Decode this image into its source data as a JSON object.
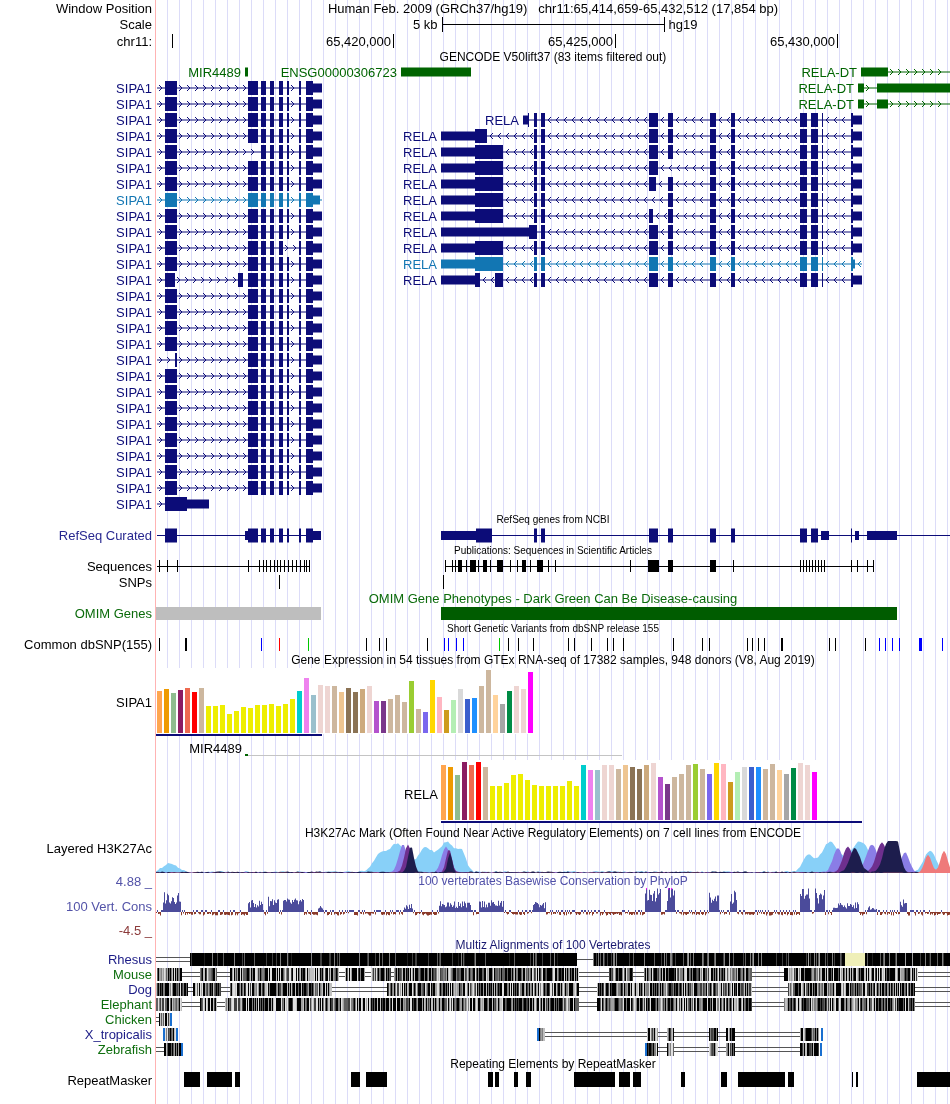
{
  "header": {
    "label": "Window Position",
    "assembly": "Human Feb. 2009 (GRCh37/hg19)",
    "position": "chr11:65,414,659-65,432,512 (17,854 bp)"
  },
  "scale": {
    "label": "Scale",
    "length": "5 kb",
    "assembly": "hg19"
  },
  "ruler": {
    "label": "chr11:",
    "ticks": [
      "65,420,000",
      "65,425,000",
      "65,430,000"
    ]
  },
  "gencode_track": {
    "title": "GENCODE V50lift37 (83 items filtered out)",
    "rows": [
      [
        {
          "label": "MIR4489",
          "color": "#006400"
        },
        {
          "label": "ENSG00000306723",
          "color": "#006400"
        },
        {
          "label": "RELA-DT",
          "color": "#006400"
        }
      ],
      [
        {
          "label": "SIPA1",
          "color": "#0c0c78"
        },
        {
          "label": "RELA-DT",
          "color": "#006400"
        }
      ],
      [
        {
          "label": "SIPA1",
          "color": "#0c0c78"
        },
        {
          "label": "RELA-DT",
          "color": "#006400"
        }
      ],
      [
        {
          "label": "SIPA1",
          "color": "#0c0c78"
        },
        {
          "label": "RELA",
          "color": "#0c0c78"
        }
      ],
      [
        {
          "label": "SIPA1",
          "color": "#0c0c78"
        },
        {
          "label": "RELA",
          "color": "#0c0c78"
        }
      ],
      [
        {
          "label": "SIPA1",
          "color": "#0c0c78"
        },
        {
          "label": "RELA",
          "color": "#0c0c78"
        }
      ],
      [
        {
          "label": "SIPA1",
          "color": "#0c0c78"
        },
        {
          "label": "RELA",
          "color": "#0c0c78"
        }
      ],
      [
        {
          "label": "SIPA1",
          "color": "#0c0c78"
        },
        {
          "label": "RELA",
          "color": "#0c0c78"
        }
      ],
      [
        {
          "label": "SIPA1",
          "color": "#1276b3"
        },
        {
          "label": "RELA",
          "color": "#0c0c78"
        }
      ],
      [
        {
          "label": "SIPA1",
          "color": "#0c0c78"
        },
        {
          "label": "RELA",
          "color": "#0c0c78"
        }
      ],
      [
        {
          "label": "SIPA1",
          "color": "#0c0c78"
        },
        {
          "label": "RELA",
          "color": "#0c0c78"
        }
      ],
      [
        {
          "label": "SIPA1",
          "color": "#0c0c78"
        },
        {
          "label": "RELA",
          "color": "#0c0c78"
        }
      ],
      [
        {
          "label": "SIPA1",
          "color": "#0c0c78"
        },
        {
          "label": "RELA",
          "color": "#1276b3"
        }
      ],
      [
        {
          "label": "SIPA1",
          "color": "#0c0c78"
        },
        {
          "label": "RELA",
          "color": "#0c0c78"
        }
      ],
      [
        {
          "label": "SIPA1",
          "color": "#0c0c78"
        }
      ],
      [
        {
          "label": "SIPA1",
          "color": "#0c0c78"
        }
      ],
      [
        {
          "label": "SIPA1",
          "color": "#0c0c78"
        }
      ],
      [
        {
          "label": "SIPA1",
          "color": "#0c0c78"
        }
      ],
      [
        {
          "label": "SIPA1",
          "color": "#0c0c78"
        }
      ],
      [
        {
          "label": "SIPA1",
          "color": "#0c0c78"
        }
      ],
      [
        {
          "label": "SIPA1",
          "color": "#0c0c78"
        }
      ],
      [
        {
          "label": "SIPA1",
          "color": "#0c0c78"
        }
      ],
      [
        {
          "label": "SIPA1",
          "color": "#0c0c78"
        }
      ],
      [
        {
          "label": "SIPA1",
          "color": "#0c0c78"
        }
      ],
      [
        {
          "label": "SIPA1",
          "color": "#0c0c78"
        }
      ],
      [
        {
          "label": "SIPA1",
          "color": "#0c0c78"
        }
      ],
      [
        {
          "label": "SIPA1",
          "color": "#0c0c78"
        }
      ],
      [
        {
          "label": "SIPA1",
          "color": "#0c0c78"
        }
      ]
    ]
  },
  "refseq_track": {
    "title": "RefSeq genes from NCBI",
    "label": "RefSeq Curated"
  },
  "publications_track": {
    "title": "Publications: Sequences in Scientific Articles",
    "label": "Sequences",
    "snp_label": "SNPs"
  },
  "omim_track": {
    "title": "OMIM Gene Phenotypes - Dark Green Can Be Disease-causing",
    "label": "OMIM Genes",
    "genes": [
      {
        "color": "#bebebe"
      },
      {
        "color": "#005c00"
      }
    ]
  },
  "dbsnp_track": {
    "title": "Short Genetic Variants from dbSNP release 155",
    "label": "Common dbSNP(155)",
    "variants": [
      {
        "color": "#000000"
      },
      {
        "color": "#000000"
      },
      {
        "color": "#0000ff"
      },
      {
        "color": "#ff0000"
      },
      {
        "color": "#00c800"
      },
      {
        "color": "#000000"
      },
      {
        "color": "#000000"
      },
      {
        "color": "#000000"
      },
      {
        "color": "#000000"
      },
      {
        "color": "#0000ff"
      },
      {
        "color": "#0000ff"
      },
      {
        "color": "#0000ff"
      },
      {
        "color": "#0000ff"
      },
      {
        "color": "#00c800"
      },
      {
        "color": "#000000"
      },
      {
        "color": "#000000"
      },
      {
        "color": "#000000"
      },
      {
        "color": "#000000"
      },
      {
        "color": "#000000"
      },
      {
        "color": "#000000"
      },
      {
        "color": "#000000"
      },
      {
        "color": "#000000"
      },
      {
        "color": "#000000"
      },
      {
        "color": "#000000"
      },
      {
        "color": "#000000"
      },
      {
        "color": "#000000"
      },
      {
        "color": "#000000"
      },
      {
        "color": "#000000"
      },
      {
        "color": "#000000"
      },
      {
        "color": "#000000"
      },
      {
        "color": "#000000"
      },
      {
        "color": "#000000"
      },
      {
        "color": "#000000"
      },
      {
        "color": "#000000"
      },
      {
        "color": "#0000ff"
      },
      {
        "color": "#0000ff"
      },
      {
        "color": "#0000ff"
      },
      {
        "color": "#0000ff"
      },
      {
        "color": "#0000ff"
      },
      {
        "color": "#0000ff"
      }
    ]
  },
  "gtex_track": {
    "title": "Gene Expression in 54 tissues from GTEx RNA-seq of 17382 samples, 948 donors (V8, Aug 2019)",
    "genes": [
      {
        "label": "SIPA1"
      },
      {
        "label": "MIR4489"
      },
      {
        "label": "RELA"
      }
    ],
    "tissues": [
      {
        "color": "#ffa54f"
      },
      {
        "color": "#ee9a00"
      },
      {
        "color": "#8fbc8f"
      },
      {
        "color": "#8b1c62"
      },
      {
        "color": "#ee6a50"
      },
      {
        "color": "#ff0000"
      },
      {
        "color": "#cdb79e"
      },
      {
        "color": "#eeee00"
      },
      {
        "color": "#eeee00"
      },
      {
        "color": "#eeee00"
      },
      {
        "color": "#eeee00"
      },
      {
        "color": "#eeee00"
      },
      {
        "color": "#eeee00"
      },
      {
        "color": "#eeee00"
      },
      {
        "color": "#eeee00"
      },
      {
        "color": "#eeee00"
      },
      {
        "color": "#eeee00"
      },
      {
        "color": "#eeee00"
      },
      {
        "color": "#eeee00"
      },
      {
        "color": "#eeee00"
      },
      {
        "color": "#00cdcd"
      },
      {
        "color": "#ee82ee"
      },
      {
        "color": "#9ac0cd"
      },
      {
        "color": "#eed5d2"
      },
      {
        "color": "#eed5d2"
      },
      {
        "color": "#cdb79e"
      },
      {
        "color": "#eec591"
      },
      {
        "color": "#8b7355"
      },
      {
        "color": "#8b7355"
      },
      {
        "color": "#cdaa7d"
      },
      {
        "color": "#eed5d2"
      },
      {
        "color": "#b452cd"
      },
      {
        "color": "#7a378b"
      },
      {
        "color": "#cdb79e"
      },
      {
        "color": "#cdb79e"
      },
      {
        "color": "#cdb79e"
      },
      {
        "color": "#9acd32"
      },
      {
        "color": "#cdb79e"
      },
      {
        "color": "#7a67ee"
      },
      {
        "color": "#ffd700"
      },
      {
        "color": "#ffb6c1"
      },
      {
        "color": "#cd9b1d"
      },
      {
        "color": "#b4eeb4"
      },
      {
        "color": "#d9d9d9"
      },
      {
        "color": "#3a5fcd"
      },
      {
        "color": "#1e90ff"
      },
      {
        "color": "#cdb79e"
      },
      {
        "color": "#cdb79e"
      },
      {
        "color": "#ffd39b"
      },
      {
        "color": "#a6a6a6"
      },
      {
        "color": "#008b45"
      },
      {
        "color": "#eed5d2"
      },
      {
        "color": "#eed5d2"
      },
      {
        "color": "#ff00ff"
      }
    ]
  },
  "h3k27ac_track": {
    "title": "H3K27Ac Mark (Often Found Near Active Regulatory Elements) on 7 cell lines from ENCODE",
    "label": "Layered H3K27Ac"
  },
  "conservation_track": {
    "title": "100 vertebrates Basewise Conservation by PhyloP",
    "label": "100 Vert. Cons",
    "max": "4.88 _",
    "min": "-4.5 _"
  },
  "multiz_track": {
    "title": "Multiz Alignments of 100 Vertebrates",
    "species": [
      {
        "label": "Rhesus",
        "color": "#1b1b86"
      },
      {
        "label": "Mouse",
        "color": "#0e6e0e"
      },
      {
        "label": "Dog",
        "color": "#1b1b86"
      },
      {
        "label": "Elephant",
        "color": "#0e6e0e"
      },
      {
        "label": "Chicken",
        "color": "#0e6e0e"
      },
      {
        "label": "X_tropicalis",
        "color": "#1b1b86"
      },
      {
        "label": "Zebrafish",
        "color": "#0e6e0e"
      }
    ]
  },
  "repeatmasker_track": {
    "title": "Repeating Elements by RepeatMasker",
    "label": "RepeatMasker"
  }
}
